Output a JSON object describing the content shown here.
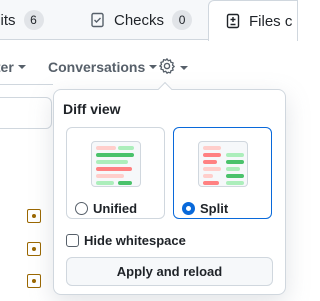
{
  "tabs": {
    "commits": {
      "label": "mits",
      "count": "6"
    },
    "checks": {
      "label": "Checks",
      "count": "0"
    },
    "files": {
      "label": "Files c"
    }
  },
  "toolbar": {
    "filter_label": "lter",
    "conversations_label": "Conversations"
  },
  "popover": {
    "title": "Diff view",
    "unified_label": "Unified",
    "split_label": "Split",
    "selected_view": "split",
    "hide_whitespace_label": "Hide whitespace",
    "hide_whitespace_checked": false,
    "apply_label": "Apply and reload"
  },
  "colors": {
    "accent": "#0969da",
    "added": "#4ac26b",
    "removed": "#ff8182",
    "commit_icon": "#9a6700"
  },
  "icons": [
    "checklist-icon",
    "file-diff-icon",
    "gear-icon",
    "caret-down-icon",
    "git-commit-icon"
  ]
}
